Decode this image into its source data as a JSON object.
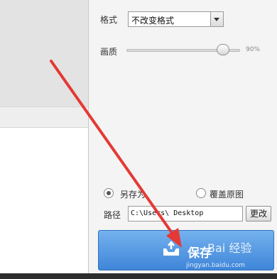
{
  "format": {
    "label": "格式",
    "selected": "不改变格式"
  },
  "quality": {
    "label": "画质",
    "value_text": "90%",
    "value": 90
  },
  "save_mode": {
    "option_save_as": "另存为",
    "option_overwrite": "覆盖原图",
    "selected": "另存为"
  },
  "path": {
    "label": "路径",
    "value": "C:\\Users\\     Desktop",
    "change_button": "更改"
  },
  "save_button": {
    "label": "保存"
  },
  "watermark": {
    "text": "Bai 经验",
    "url": "jingyan.baidu.com"
  },
  "colors": {
    "save_button": "#4a90e2",
    "annotation_arrow": "#e53935"
  }
}
